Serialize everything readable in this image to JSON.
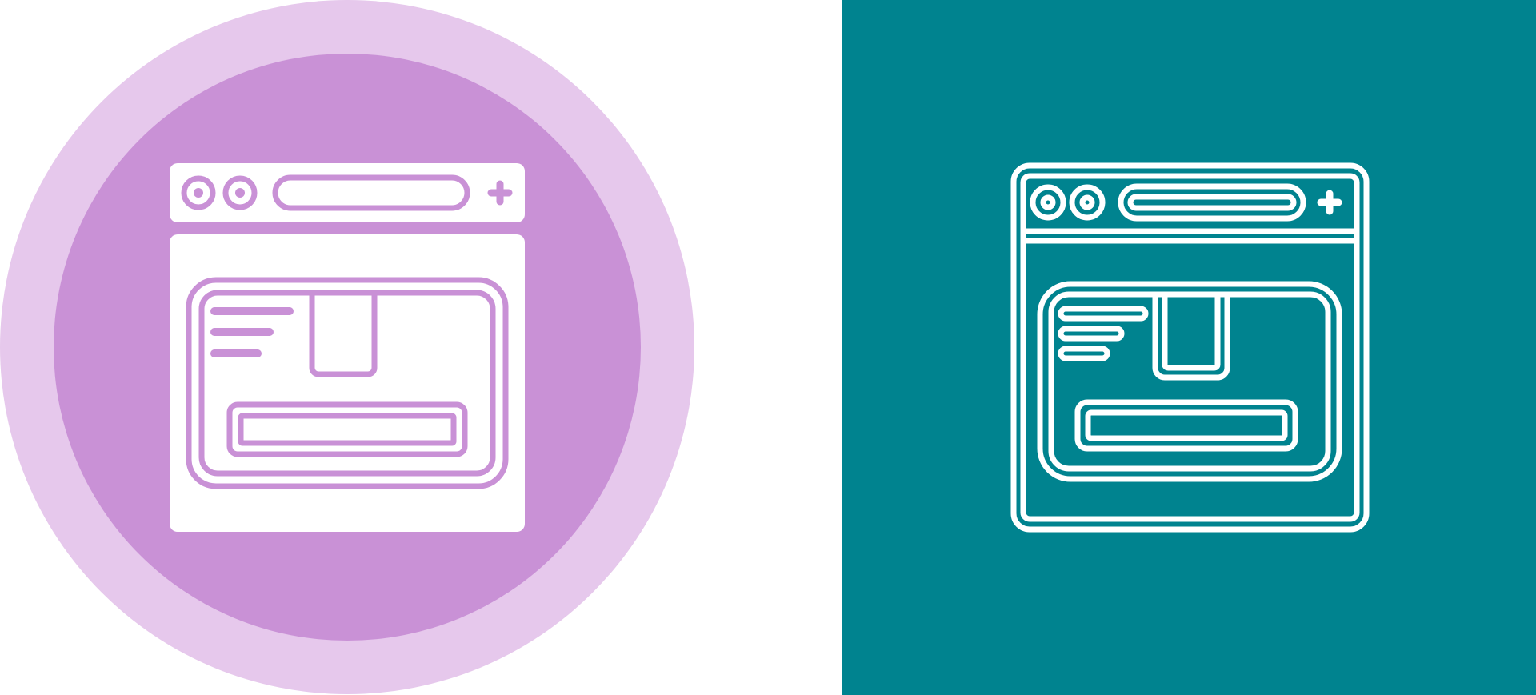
{
  "variants": [
    {
      "style": "glyph",
      "icon": "browser-window-package-icon",
      "background_shape": "circle",
      "colors": {
        "outer_ring": "#E6C8EC",
        "inner_circle": "#C991D6",
        "glyph": "#FFFFFF"
      }
    },
    {
      "style": "line",
      "icon": "browser-window-package-icon",
      "background_shape": "square",
      "colors": {
        "background": "#00838F",
        "stroke": "#FFFFFF"
      }
    }
  ],
  "page_background": "#FFFFFF"
}
